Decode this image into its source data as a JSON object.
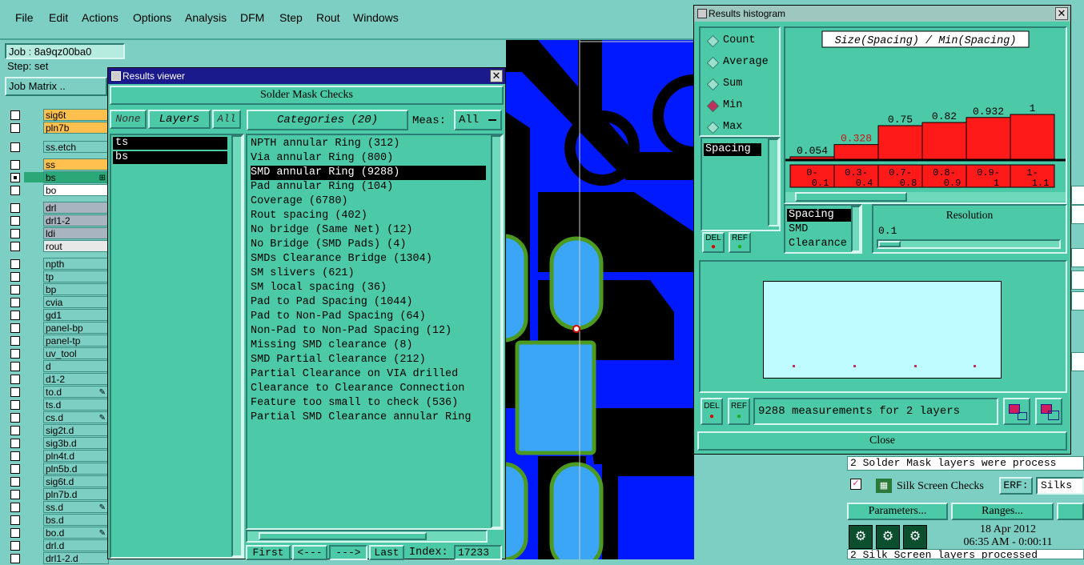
{
  "menu": [
    "File",
    "Edit",
    "Actions",
    "Options",
    "Analysis",
    "DFM",
    "Step",
    "Rout",
    "Windows"
  ],
  "job": {
    "job_label": "Job : 8a9qz00ba0",
    "step_label": "Step: set",
    "job_matrix": "Job Matrix .."
  },
  "layers": [
    {
      "name": "sig6t",
      "color": "#ffc04d",
      "checked": false,
      "mark": ""
    },
    {
      "name": "pln7b",
      "color": "#ffc04d",
      "checked": false,
      "mark": ""
    },
    {
      "name": "ss.etch",
      "color": "#7ecfc3",
      "checked": false,
      "mark": ""
    },
    {
      "name": "ss",
      "color": "#ffc04d",
      "checked": false,
      "mark": ""
    },
    {
      "name": "bs",
      "color": "#2aa878",
      "checked": true,
      "mark": "⊞"
    },
    {
      "name": "bo",
      "color": "#ffffff",
      "checked": false,
      "mark": ""
    },
    {
      "name": "drl",
      "color": "#a8b4bf",
      "checked": false,
      "mark": ""
    },
    {
      "name": "drl1-2",
      "color": "#a8b4bf",
      "checked": false,
      "mark": ""
    },
    {
      "name": "ldi",
      "color": "#a8b4bf",
      "checked": false,
      "mark": ""
    },
    {
      "name": "rout",
      "color": "#e8e8e8",
      "checked": false,
      "mark": ""
    },
    {
      "name": "npth",
      "color": "#7ecfc3",
      "checked": false,
      "mark": ""
    },
    {
      "name": "tp",
      "color": "#7ecfc3",
      "checked": false,
      "mark": ""
    },
    {
      "name": "bp",
      "color": "#7ecfc3",
      "checked": false,
      "mark": ""
    },
    {
      "name": "cvia",
      "color": "#7ecfc3",
      "checked": false,
      "mark": ""
    },
    {
      "name": "gd1",
      "color": "#7ecfc3",
      "checked": false,
      "mark": ""
    },
    {
      "name": "panel-bp",
      "color": "#7ecfc3",
      "checked": false,
      "mark": ""
    },
    {
      "name": "panel-tp",
      "color": "#7ecfc3",
      "checked": false,
      "mark": ""
    },
    {
      "name": "uv_tool",
      "color": "#7ecfc3",
      "checked": false,
      "mark": ""
    },
    {
      "name": "d",
      "color": "#7ecfc3",
      "checked": false,
      "mark": ""
    },
    {
      "name": "d1-2",
      "color": "#7ecfc3",
      "checked": false,
      "mark": ""
    },
    {
      "name": "to.d",
      "color": "#7ecfc3",
      "checked": false,
      "mark": "✎"
    },
    {
      "name": "ts.d",
      "color": "#7ecfc3",
      "checked": false,
      "mark": ""
    },
    {
      "name": "cs.d",
      "color": "#7ecfc3",
      "checked": false,
      "mark": "✎"
    },
    {
      "name": "sig2t.d",
      "color": "#7ecfc3",
      "checked": false,
      "mark": ""
    },
    {
      "name": "sig3b.d",
      "color": "#7ecfc3",
      "checked": false,
      "mark": ""
    },
    {
      "name": "pln4t.d",
      "color": "#7ecfc3",
      "checked": false,
      "mark": ""
    },
    {
      "name": "pln5b.d",
      "color": "#7ecfc3",
      "checked": false,
      "mark": ""
    },
    {
      "name": "sig6t.d",
      "color": "#7ecfc3",
      "checked": false,
      "mark": ""
    },
    {
      "name": "pln7b.d",
      "color": "#7ecfc3",
      "checked": false,
      "mark": ""
    },
    {
      "name": "ss.d",
      "color": "#7ecfc3",
      "checked": false,
      "mark": "✎"
    },
    {
      "name": "bs.d",
      "color": "#7ecfc3",
      "checked": false,
      "mark": ""
    },
    {
      "name": "bo.d",
      "color": "#7ecfc3",
      "checked": false,
      "mark": "✎"
    },
    {
      "name": "drl.d",
      "color": "#7ecfc3",
      "checked": false,
      "mark": ""
    },
    {
      "name": "drl1-2.d",
      "color": "#7ecfc3",
      "checked": false,
      "mark": ""
    }
  ],
  "results_viewer": {
    "title": "Results viewer",
    "heading": "Solder Mask Checks",
    "none_btn": "None",
    "layers_btn": "Layers",
    "all_btn": "All",
    "categories_btn": "Categories (20)",
    "meas_label": "Meas:",
    "meas_value": "All",
    "layer_list": [
      "ts",
      "bs"
    ],
    "categories": [
      "NPTH annular Ring (312)",
      "Via annular Ring (800)",
      "SMD annular Ring (9288)",
      "Pad annular Ring (104)",
      "Coverage (6780)",
      "Rout spacing (402)",
      "No bridge (Same Net) (12)",
      "No Bridge (SMD Pads) (4)",
      "SMDs Clearance Bridge (1304)",
      "SM slivers (621)",
      "SM local spacing (36)",
      "Pad to Pad Spacing (1044)",
      "Pad to Non-Pad Spacing (64)",
      "Non-Pad to Non-Pad Spacing (12)",
      "Missing SMD clearance (8)",
      "SMD Partial Clearance (212)",
      "Partial Clearance on VIA drilled",
      "Clearance to Clearance Connection",
      "Feature too small to check (536)",
      "Partial SMD Clearance annular Ring"
    ],
    "selected_index": 2,
    "nav": {
      "first": "First",
      "prev": "<---",
      "next": "--->",
      "last": "Last",
      "index_label": "Index:",
      "index_value": "17233"
    }
  },
  "histogram": {
    "title": "Results histogram",
    "modes": [
      "Count",
      "Average",
      "Sum",
      "Min",
      "Max"
    ],
    "selected_mode": 3,
    "chart_title": "Size(Spacing) / Min(Spacing)",
    "meas_list": [
      "Spacing"
    ],
    "del": "DEL",
    "ref": "REF",
    "type_list": [
      "Spacing",
      "SMD",
      "Clearance"
    ],
    "resolution_label": "Resolution",
    "resolution_value": "0.1",
    "status": "9288 measurements for 2 layers",
    "close": "Close"
  },
  "chart_data": {
    "type": "bar",
    "title": "Size(Spacing) / Min(Spacing)",
    "categories": [
      "0-0.1",
      "0.3-0.4",
      "0.7-0.8",
      "0.8-0.9",
      "0.9-1",
      "1-1.1"
    ],
    "values": [
      0.054,
      0.328,
      0.75,
      0.82,
      0.932,
      1
    ],
    "value_labels": [
      "0.054",
      "0.328",
      "0.75",
      "0.82",
      "0.932",
      "1"
    ],
    "ylim": [
      0,
      1
    ]
  },
  "bottom_right": {
    "line1": "2 Solder Mask layers were process",
    "check_name": "Silk Screen Checks",
    "erf_label": "ERF:",
    "erf_value": "Silks",
    "parameters": "Parameters...",
    "ranges": "Ranges...",
    "date": "18 Apr 2012",
    "time": "06:35 AM - 0:00:11",
    "line2": "2 Silk Screen layers processed"
  },
  "colors": {
    "board_blue": "#0019ff",
    "pad_blue": "#3aa6f5",
    "pad_outline": "#4c9a20",
    "ui_teal": "#4cc9a6",
    "bar_red": "#ff1a1a"
  }
}
